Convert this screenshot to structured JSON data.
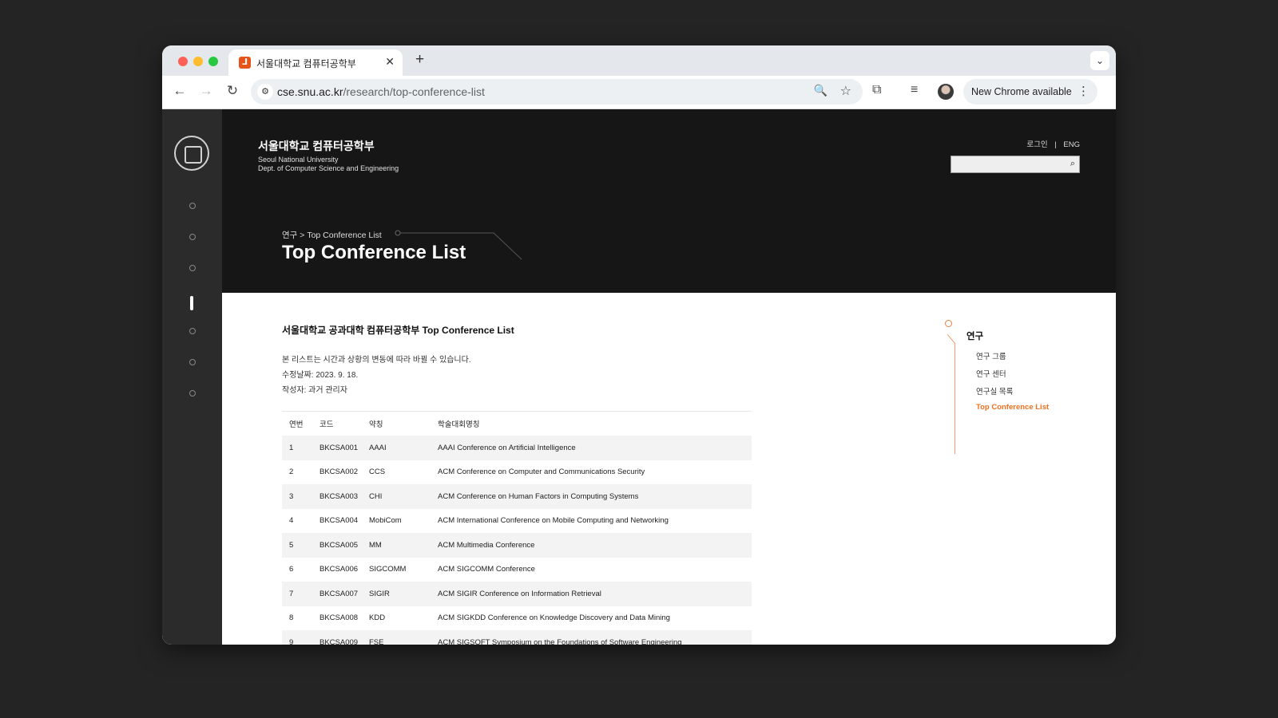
{
  "browser": {
    "tab_title": "서울대학교 컴퓨터공학부",
    "tab_favicon_glyph": "⅃",
    "url_host": "cse.snu.ac.kr",
    "url_path": "/research/top-conference-list",
    "update_label": "New Chrome available"
  },
  "header": {
    "name_ko": "서울대학교 컴퓨터공학부",
    "name_en_line1": "Seoul National University",
    "name_en_line2": "Dept. of Computer Science and Engineering",
    "login_label": "로그인",
    "separator": "|",
    "lang_label": "ENG",
    "search_value": ""
  },
  "breadcrumb": {
    "parent": "연구",
    "separator": ">",
    "current": "Top Conference List"
  },
  "page_title": "Top Conference List",
  "document": {
    "heading": "서울대학교 공과대학 컴퓨터공학부 Top Conference List",
    "note1": "본 리스트는 시간과 상황의 변동에 따라 바뀔 수 있습니다.",
    "note2": "수정날짜: 2023. 9. 18.",
    "note3": "작성자: 과거 관리자"
  },
  "table": {
    "headers": [
      "연번",
      "코드",
      "약칭",
      "학술대회명칭"
    ],
    "rows": [
      [
        "1",
        "BKCSA001",
        "AAAI",
        "AAAI Conference on Artificial Intelligence"
      ],
      [
        "2",
        "BKCSA002",
        "CCS",
        "ACM Conference on Computer and Communications Security"
      ],
      [
        "3",
        "BKCSA003",
        "CHI",
        "ACM Conference on Human Factors in Computing Systems"
      ],
      [
        "4",
        "BKCSA004",
        "MobiCom",
        "ACM International Conference on Mobile Computing and Networking"
      ],
      [
        "5",
        "BKCSA005",
        "MM",
        "ACM Multimedia Conference"
      ],
      [
        "6",
        "BKCSA006",
        "SIGCOMM",
        "ACM SIGCOMM Conference"
      ],
      [
        "7",
        "BKCSA007",
        "SIGIR",
        "ACM SIGIR Conference on Information Retrieval"
      ],
      [
        "8",
        "BKCSA008",
        "KDD",
        "ACM SIGKDD Conference on Knowledge Discovery and Data Mining"
      ],
      [
        "9",
        "BKCSA009",
        "FSE",
        "ACM SIGSOFT Symposium on the Foundations of Software Engineering"
      ]
    ]
  },
  "subnav": {
    "title": "연구",
    "items": [
      "연구 그룹",
      "연구 센터",
      "연구실 목록",
      "Top Conference List"
    ],
    "active_index": 3
  },
  "colors": {
    "accent": "#f07020",
    "hero_bg": "#161616",
    "rail_bg": "#2b2b2b"
  },
  "icons": [
    "close-icon",
    "plus-icon",
    "chevron-down-icon",
    "back-arrow-icon",
    "forward-arrow-icon",
    "reload-icon",
    "site-info-icon",
    "zoom-icon",
    "star-icon",
    "extensions-icon",
    "media-icon",
    "more-icon",
    "search-icon"
  ]
}
